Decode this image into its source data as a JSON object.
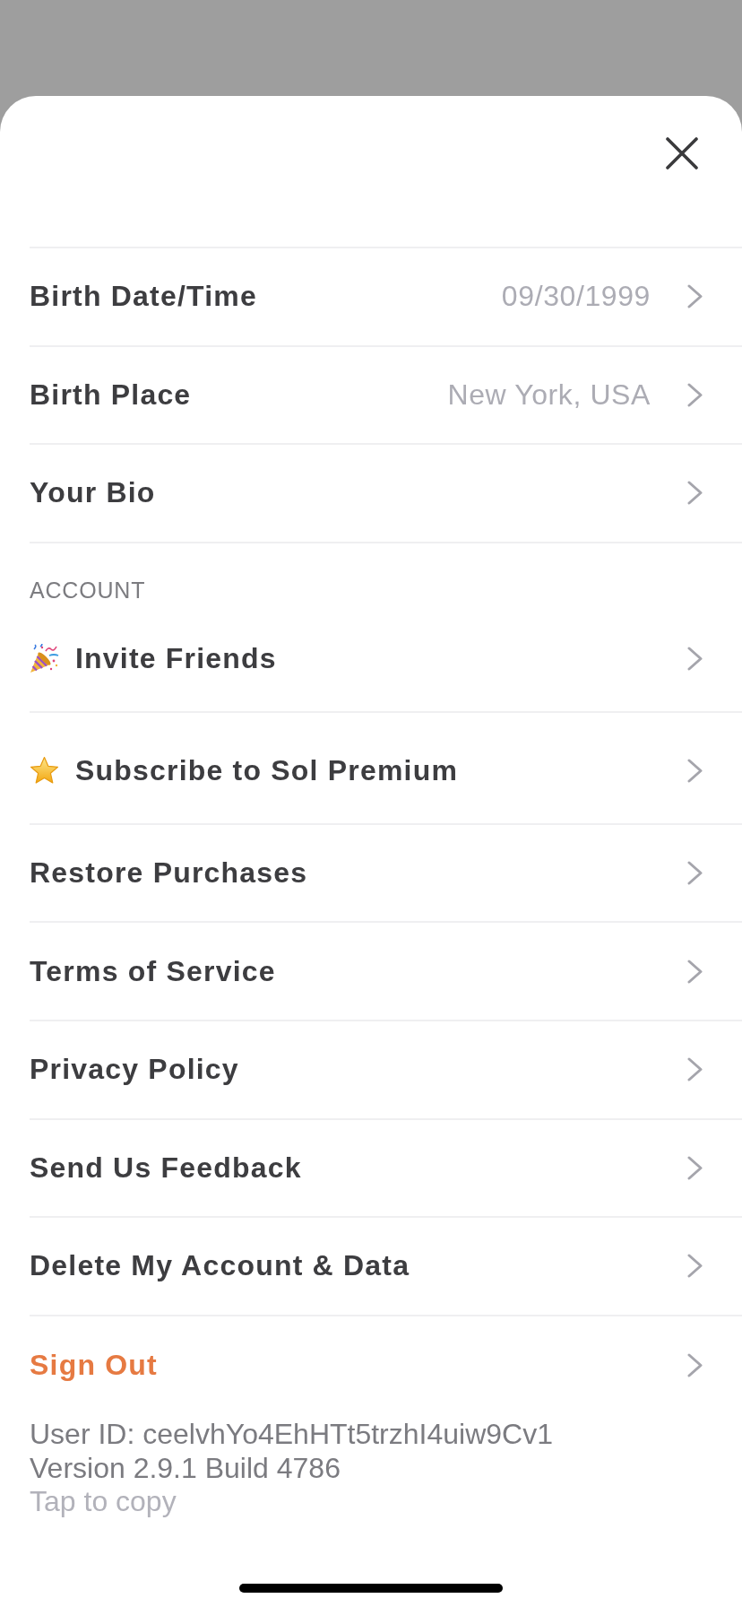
{
  "sections": [
    {
      "rows": [
        {
          "kind": "plain",
          "label": "Birth Date/Time",
          "value": "09/30/1999"
        },
        {
          "kind": "plain",
          "label": "Birth Place",
          "value": "New York, USA"
        },
        {
          "kind": "plain",
          "label": "Your Bio"
        }
      ]
    },
    {
      "header": "ACCOUNT",
      "rows": [
        {
          "kind": "party",
          "label": "Invite Friends"
        },
        {
          "kind": "star",
          "label": "Subscribe to Sol Premium"
        },
        {
          "kind": "plain",
          "label": "Restore Purchases"
        },
        {
          "kind": "plain",
          "label": "Terms of Service"
        },
        {
          "kind": "plain",
          "label": "Privacy Policy"
        },
        {
          "kind": "plain",
          "label": "Send Us Feedback"
        },
        {
          "kind": "plain",
          "label": "Delete My Account & Data"
        },
        {
          "kind": "signout",
          "label": "Sign Out"
        }
      ]
    }
  ],
  "footer": {
    "user_id": "User ID: ceelvhYo4EhHTt5trzhI4uiw9Cv1",
    "version": "Version 2.9.1 Build 4786",
    "hint": "Tap to copy"
  }
}
